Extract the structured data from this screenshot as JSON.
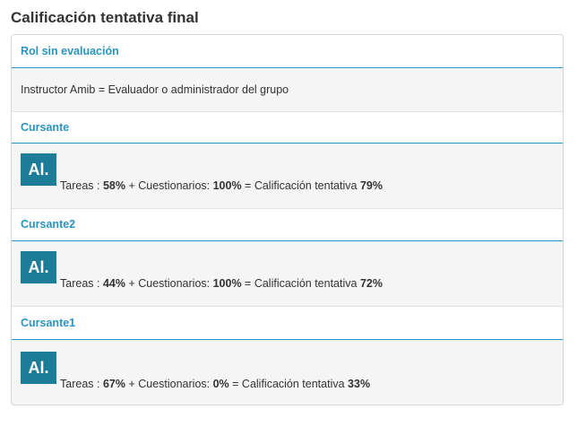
{
  "page": {
    "title": "Calificación tentativa final"
  },
  "role_section": {
    "header": "Rol sin evaluación",
    "text": "Instructor Amib = Evaluador o administrador del grupo"
  },
  "students": [
    {
      "name": "Cursante",
      "avatar_text": "Al.",
      "tareas_label": "Tareas : ",
      "tareas_value": "58%",
      "plus_label": " + Cuestionarios: ",
      "cuestionarios_value": "100%",
      "equals_label": " = Calificación tentativa ",
      "final_value": "79%"
    },
    {
      "name": "Cursante2",
      "avatar_text": "Al.",
      "tareas_label": "Tareas : ",
      "tareas_value": "44%",
      "plus_label": " + Cuestionarios: ",
      "cuestionarios_value": "100%",
      "equals_label": " = Calificación tentativa ",
      "final_value": "72%"
    },
    {
      "name": "Cursante1",
      "avatar_text": "Al.",
      "tareas_label": "Tareas : ",
      "tareas_value": "67%",
      "plus_label": " + Cuestionarios: ",
      "cuestionarios_value": "0%",
      "equals_label": " = Calificación tentativa ",
      "final_value": "33%"
    }
  ],
  "colors": {
    "accent": "#2a94c1",
    "avatar_bg": "#1d7d98",
    "panel_bg": "#f5f5f5"
  }
}
